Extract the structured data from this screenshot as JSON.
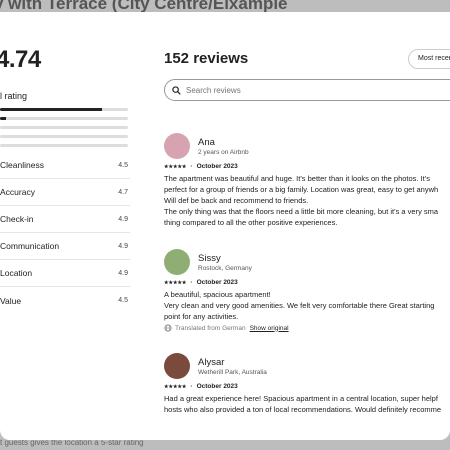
{
  "background": {
    "title": "y with Terrace (City Centre/Eixample",
    "footer": "t guests gives the location a 5-star rating"
  },
  "ratings": {
    "overall_score": "4.74",
    "overall_label": "ll rating",
    "distribution": [
      0.8,
      0.05,
      0.0,
      0.0,
      0.0
    ],
    "categories": [
      {
        "label": "Cleanliness",
        "value": "4.5"
      },
      {
        "label": "Accuracy",
        "value": "4.7"
      },
      {
        "label": "Check-in",
        "value": "4.9"
      },
      {
        "label": "Communication",
        "value": "4.9"
      },
      {
        "label": "Location",
        "value": "4.9"
      },
      {
        "label": "Value",
        "value": "4.5"
      }
    ]
  },
  "reviews_header": {
    "count_label": "152 reviews",
    "sort_label": "Most recent",
    "search_placeholder": "Search reviews"
  },
  "reviews": [
    {
      "name": "Ana",
      "subtitle": "2 years on Airbnb",
      "stars": "★★★★★",
      "date": "October 2023",
      "lines": [
        "The apartment was beautiful and huge. It's better than it looks on the photos. It's",
        "perfect for a group of friends or a big family. Location was great, easy to get anywh",
        "Will def be back and recommend to friends.",
        "The only thing was that the floors need a little bit more cleaning, but it's a very sma",
        "thing compared to all the other positive experiences."
      ],
      "avatar_color": "#d8a3b0"
    },
    {
      "name": "Sissy",
      "subtitle": "Rostock, Germany",
      "stars": "★★★★★",
      "date": "October 2023",
      "lines": [
        "A beautiful, spacious apartment!",
        "Very clean and very good amenities. We felt very comfortable there Great starting",
        "point for any activities."
      ],
      "translated_note": "Translated from German",
      "show_original": "Show original",
      "avatar_color": "#8fae74"
    },
    {
      "name": "Alysar",
      "subtitle": "Wetherill Park, Australia",
      "stars": "★★★★★",
      "date": "October 2023",
      "lines": [
        "Had a great experience here! Spacious apartment in a central location, super helpf",
        "hosts who also provided a ton of local recommendations. Would definitely recomme"
      ],
      "avatar_color": "#7a4a3c"
    }
  ]
}
